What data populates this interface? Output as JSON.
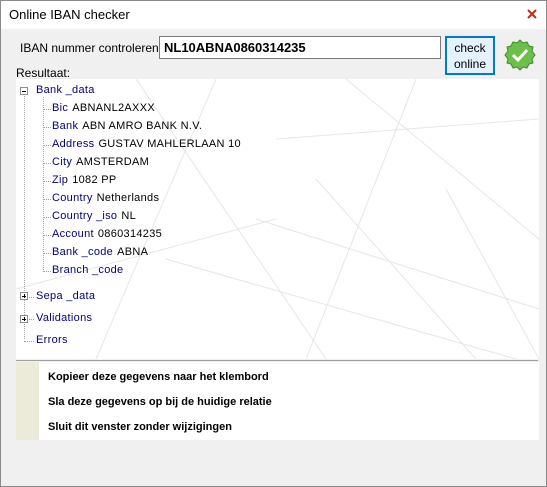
{
  "window": {
    "title": "Online IBAN checker"
  },
  "form": {
    "iban_label": "IBAN nummer controleren:",
    "iban_value": "NL10ABNA0860314235",
    "check_button_line1": "check",
    "check_button_line2": "online",
    "result_label": "Resultaat:"
  },
  "tree": {
    "bank_data": "Bank _data",
    "fields": [
      {
        "key": "Bic",
        "value": "ABNANL2AXXX"
      },
      {
        "key": "Bank",
        "value": "ABN AMRO BANK N.V."
      },
      {
        "key": "Address",
        "value": "GUSTAV MAHLERLAAN 10"
      },
      {
        "key": "City",
        "value": "AMSTERDAM"
      },
      {
        "key": "Zip",
        "value": "1082 PP"
      },
      {
        "key": "Country",
        "value": "Netherlands"
      },
      {
        "key": "Country _iso",
        "value": "NL"
      },
      {
        "key": "Account",
        "value": "0860314235"
      },
      {
        "key": "Bank _code",
        "value": "ABNA"
      },
      {
        "key": "Branch _code",
        "value": ""
      }
    ],
    "sepa_data": "Sepa _data",
    "validations": "Validations",
    "errors": "Errors"
  },
  "actions": {
    "copy": "Kopieer deze gegevens naar het klembord",
    "save": "Sla deze gegevens op bij de huidige relatie",
    "close": "Sluit dit venster zonder wijzigingen"
  },
  "icons": {
    "ok": "check-circle-icon",
    "close": "close-icon"
  },
  "colors": {
    "tree_key": "#000080",
    "button_border": "#0078d7",
    "ok_green": "#6cc04a"
  }
}
